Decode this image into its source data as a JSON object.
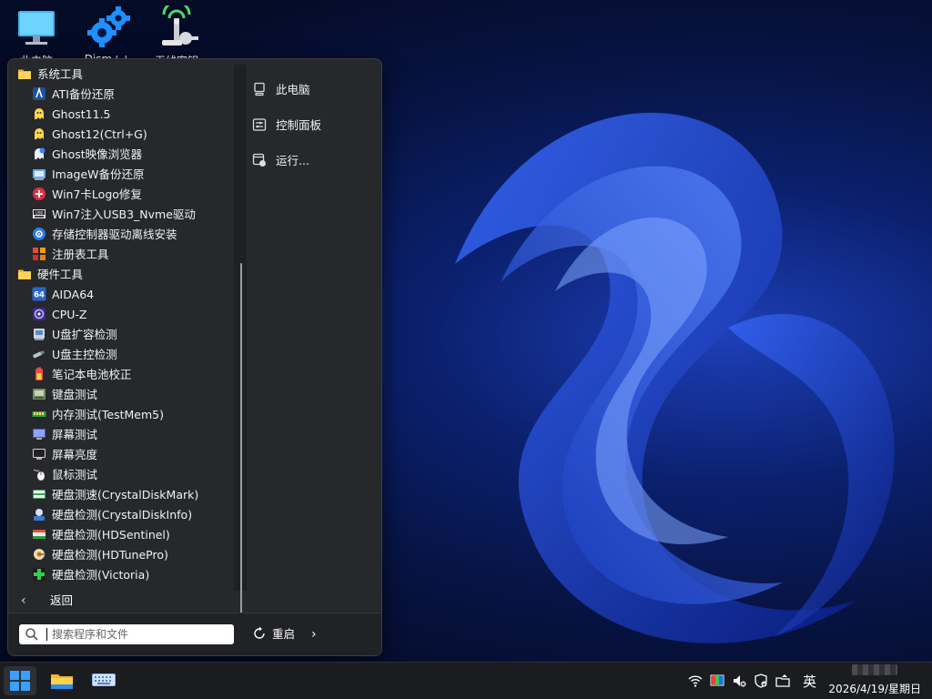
{
  "desktop": {
    "icons": [
      {
        "label": "此电脑"
      },
      {
        "label": "Dism++"
      },
      {
        "label": "无线密钥"
      }
    ]
  },
  "start_menu": {
    "tree": [
      {
        "kind": "folder",
        "label": "系统工具",
        "icon": "folder-icon"
      },
      {
        "kind": "item",
        "label": "ATI备份还原",
        "icon": "ati-icon"
      },
      {
        "kind": "item",
        "label": "Ghost11.5",
        "icon": "ghost-icon"
      },
      {
        "kind": "item",
        "label": "Ghost12(Ctrl+G)",
        "icon": "ghost-icon"
      },
      {
        "kind": "item",
        "label": "Ghost映像浏览器",
        "icon": "ghost-explorer-icon"
      },
      {
        "kind": "item",
        "label": "ImageW备份还原",
        "icon": "imagew-icon"
      },
      {
        "kind": "item",
        "label": "Win7卡Logo修复",
        "icon": "repair-icon"
      },
      {
        "kind": "item",
        "label": "Win7注入USB3_Nvme驱动",
        "icon": "driver-icon"
      },
      {
        "kind": "item",
        "label": "存储控制器驱动离线安装",
        "icon": "gear-icon"
      },
      {
        "kind": "item",
        "label": "注册表工具",
        "icon": "registry-icon"
      },
      {
        "kind": "folder",
        "label": "硬件工具",
        "icon": "folder-icon"
      },
      {
        "kind": "item",
        "label": "AIDA64",
        "icon": "aida64-icon"
      },
      {
        "kind": "item",
        "label": "CPU-Z",
        "icon": "cpuz-icon"
      },
      {
        "kind": "item",
        "label": "U盘扩容检测",
        "icon": "usb-check-icon"
      },
      {
        "kind": "item",
        "label": "U盘主控检测",
        "icon": "usb-icon"
      },
      {
        "kind": "item",
        "label": "笔记本电池校正",
        "icon": "battery-icon"
      },
      {
        "kind": "item",
        "label": "键盘测试",
        "icon": "keyboard-icon"
      },
      {
        "kind": "item",
        "label": "内存测试(TestMem5)",
        "icon": "memory-icon"
      },
      {
        "kind": "item",
        "label": "屏幕测试",
        "icon": "screen-test-icon"
      },
      {
        "kind": "item",
        "label": "屏幕亮度",
        "icon": "monitor-icon"
      },
      {
        "kind": "item",
        "label": "鼠标测试",
        "icon": "mouse-icon"
      },
      {
        "kind": "item",
        "label": "硬盘测速(CrystalDiskMark)",
        "icon": "disk-mark-icon"
      },
      {
        "kind": "item",
        "label": "硬盘检测(CrystalDiskInfo)",
        "icon": "disk-info-icon"
      },
      {
        "kind": "item",
        "label": "硬盘检测(HDSentinel)",
        "icon": "disk-sentinel-icon"
      },
      {
        "kind": "item",
        "label": "硬盘检测(HDTunePro)",
        "icon": "hdtune-icon"
      },
      {
        "kind": "item",
        "label": "硬盘检测(Victoria)",
        "icon": "victoria-icon"
      }
    ],
    "right_items": [
      {
        "label": "此电脑",
        "icon": "computer-icon"
      },
      {
        "label": "控制面板",
        "icon": "control-panel-icon"
      },
      {
        "label": "运行...",
        "icon": "run-icon"
      }
    ],
    "back_label": "返回",
    "search_placeholder": "搜索程序和文件",
    "restart_label": "重启"
  },
  "taskbar": {
    "language": "英",
    "clock": "2026/4/19/星期日"
  },
  "colors": {
    "menu_bg": "#26282b",
    "taskbar_bg": "#1a1c20",
    "accent": "#0078d4",
    "folder": "#f5c542"
  }
}
